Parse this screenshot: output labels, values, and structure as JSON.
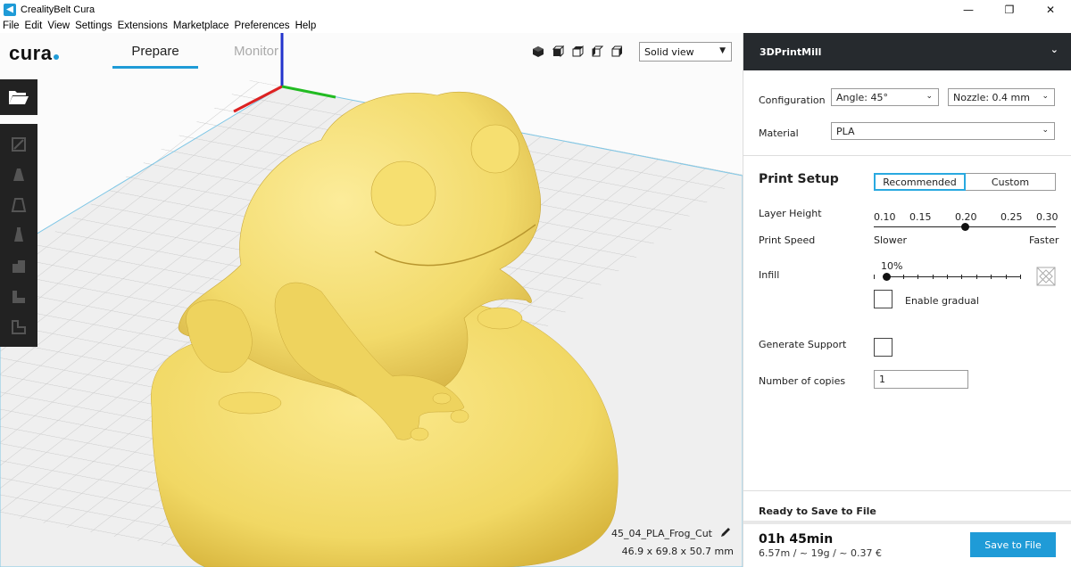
{
  "window": {
    "title": "CrealityBelt Cura",
    "minimize": "—",
    "maximize": "❐",
    "close": "✕"
  },
  "menu": [
    "File",
    "Edit",
    "View",
    "Settings",
    "Extensions",
    "Marketplace",
    "Preferences",
    "Help"
  ],
  "header": {
    "logo": "cura",
    "tabs": {
      "prepare": "Prepare",
      "monitor": "Monitor"
    },
    "view_mode": "Solid view"
  },
  "object": {
    "name": "45_04_PLA_Frog_Cut",
    "dimensions": "46.9 x 69.8 x 50.7 mm",
    "color": "#f4e078"
  },
  "panel": {
    "printer": "3DPrintMill",
    "configuration_label": "Configuration",
    "angle": "Angle: 45°",
    "nozzle": "Nozzle: 0.4 mm",
    "material_label": "Material",
    "material": "PLA",
    "print_setup": "Print Setup",
    "mode_recommended": "Recommended",
    "mode_custom": "Custom",
    "layer_height_label": "Layer Height",
    "layer_ticks": [
      "0.10",
      "0.15",
      "0.20",
      "0.25",
      "0.30"
    ],
    "layer_height_value": 0.2,
    "print_speed_label": "Print Speed",
    "speed_slow": "Slower",
    "speed_fast": "Faster",
    "infill_label": "Infill",
    "infill_value": "10%",
    "infill_fraction": 0.1,
    "enable_gradual": "Enable gradual",
    "support_label": "Generate Support",
    "copies_label": "Number of copies",
    "copies": "1"
  },
  "footer": {
    "status": "Ready to Save to File",
    "time": "01h 45min",
    "cost": "6.57m / ~ 19g / ~ 0.37 €",
    "save": "Save to File"
  },
  "colors": {
    "accent": "#1f9bd7",
    "header_bg": "#262a2e"
  }
}
